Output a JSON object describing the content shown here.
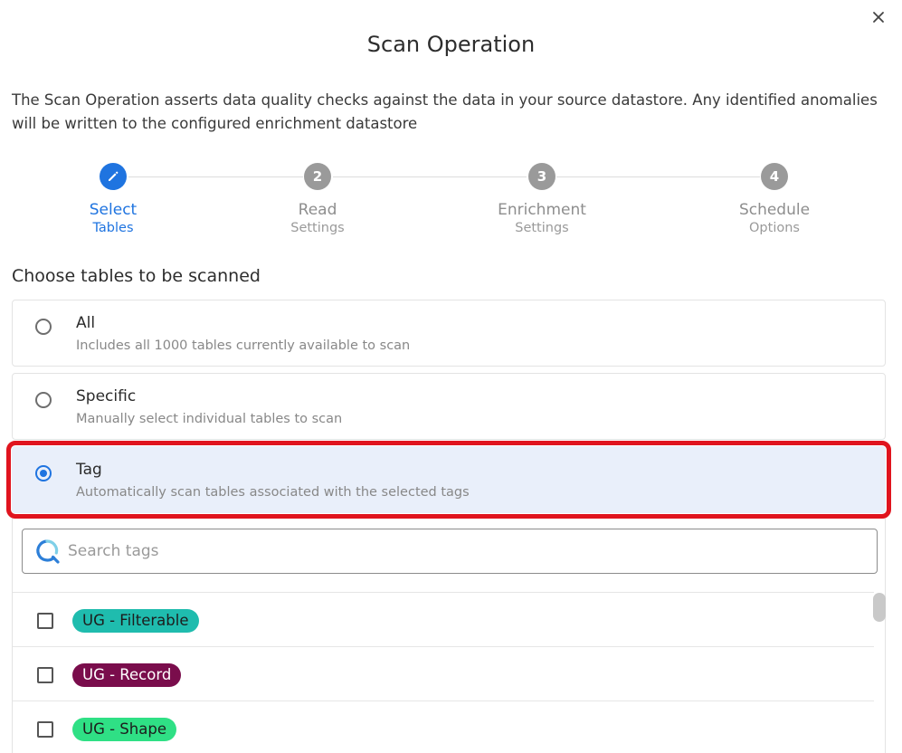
{
  "dialog": {
    "title": "Scan Operation",
    "description": "The Scan Operation asserts data quality checks against the data in your source datastore. Any identified anomalies will be written to the configured enrichment datastore"
  },
  "stepper": {
    "steps": [
      {
        "number": "",
        "line1": "Select",
        "line2": "Tables",
        "icon": "pencil-icon",
        "active": true
      },
      {
        "number": "2",
        "line1": "Read",
        "line2": "Settings",
        "active": false
      },
      {
        "number": "3",
        "line1": "Enrichment",
        "line2": "Settings",
        "active": false
      },
      {
        "number": "4",
        "line1": "Schedule",
        "line2": "Options",
        "active": false
      }
    ]
  },
  "section": {
    "title": "Choose tables to be scanned"
  },
  "options": [
    {
      "title": "All",
      "description": "Includes all 1000 tables currently available to scan",
      "selected": false
    },
    {
      "title": "Specific",
      "description": "Manually select individual tables to scan",
      "selected": false
    },
    {
      "title": "Tag",
      "description": "Automatically scan tables associated with the selected tags",
      "selected": true
    }
  ],
  "search": {
    "placeholder": "Search tags",
    "value": ""
  },
  "tags": [
    {
      "label": "UG - Filterable",
      "color": "#1fbcae",
      "text_color": "#1d1d1d",
      "checked": false
    },
    {
      "label": "UG - Record",
      "color": "#7a0d4c",
      "text_color": "#ffffff",
      "checked": false
    },
    {
      "label": "UG - Shape",
      "color": "#2fe085",
      "text_color": "#1d1d1d",
      "checked": false
    }
  ],
  "colors": {
    "accent": "#1f74e0",
    "highlight": "#e0141e",
    "selected_bg": "#e9effa"
  }
}
